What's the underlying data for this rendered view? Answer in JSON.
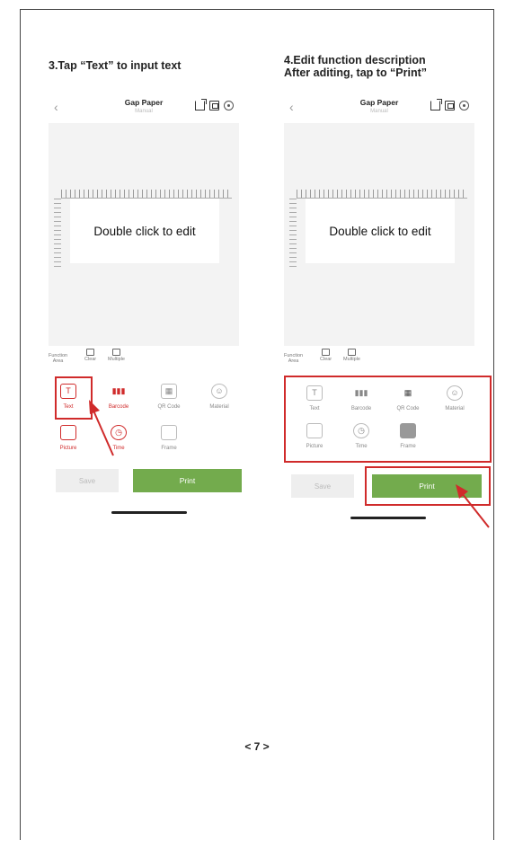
{
  "steps": {
    "step3_title": "3.Tap “Text” to input text",
    "step4_title_line1": "4.Edit function description",
    "step4_title_line2": "After aditing, tap to “Print”"
  },
  "app": {
    "title": "Gap Paper",
    "subtitle": "Manual",
    "canvas_text": "Double click to edit",
    "function_strip": {
      "area_label_1": "Function",
      "area_label_2": "Area",
      "clear_label": "Clear",
      "multiple_label": "Multiple"
    },
    "tools": {
      "text": "Text",
      "barcode": "Barcode",
      "qr_code": "QR Code",
      "material": "Material",
      "picture": "Picture",
      "time": "Time",
      "frame": "Frame"
    },
    "save_label": "Save",
    "print_label": "Print"
  },
  "colors": {
    "print_green": "#73ab4d",
    "highlight_red": "#d02b2b",
    "canvas_bg": "#f3f3f3"
  },
  "icons": [
    "back-chevron-icon",
    "export-icon",
    "template-icon",
    "settings-icon",
    "text-icon",
    "barcode-icon",
    "qr-code-icon",
    "material-icon",
    "picture-icon",
    "clock-icon",
    "frame-icon"
  ],
  "page_number": "< 7 >"
}
